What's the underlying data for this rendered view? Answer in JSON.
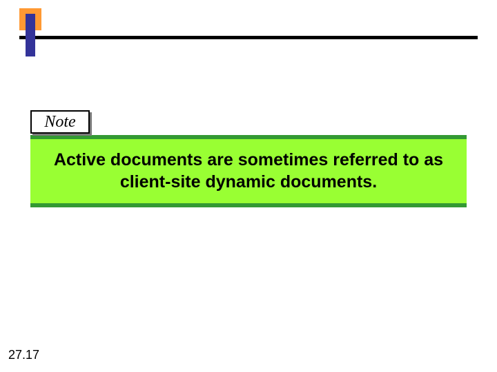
{
  "note": {
    "label": "Note",
    "body": "Active documents are sometimes referred to as client-site dynamic documents."
  },
  "page_number": "27.17"
}
